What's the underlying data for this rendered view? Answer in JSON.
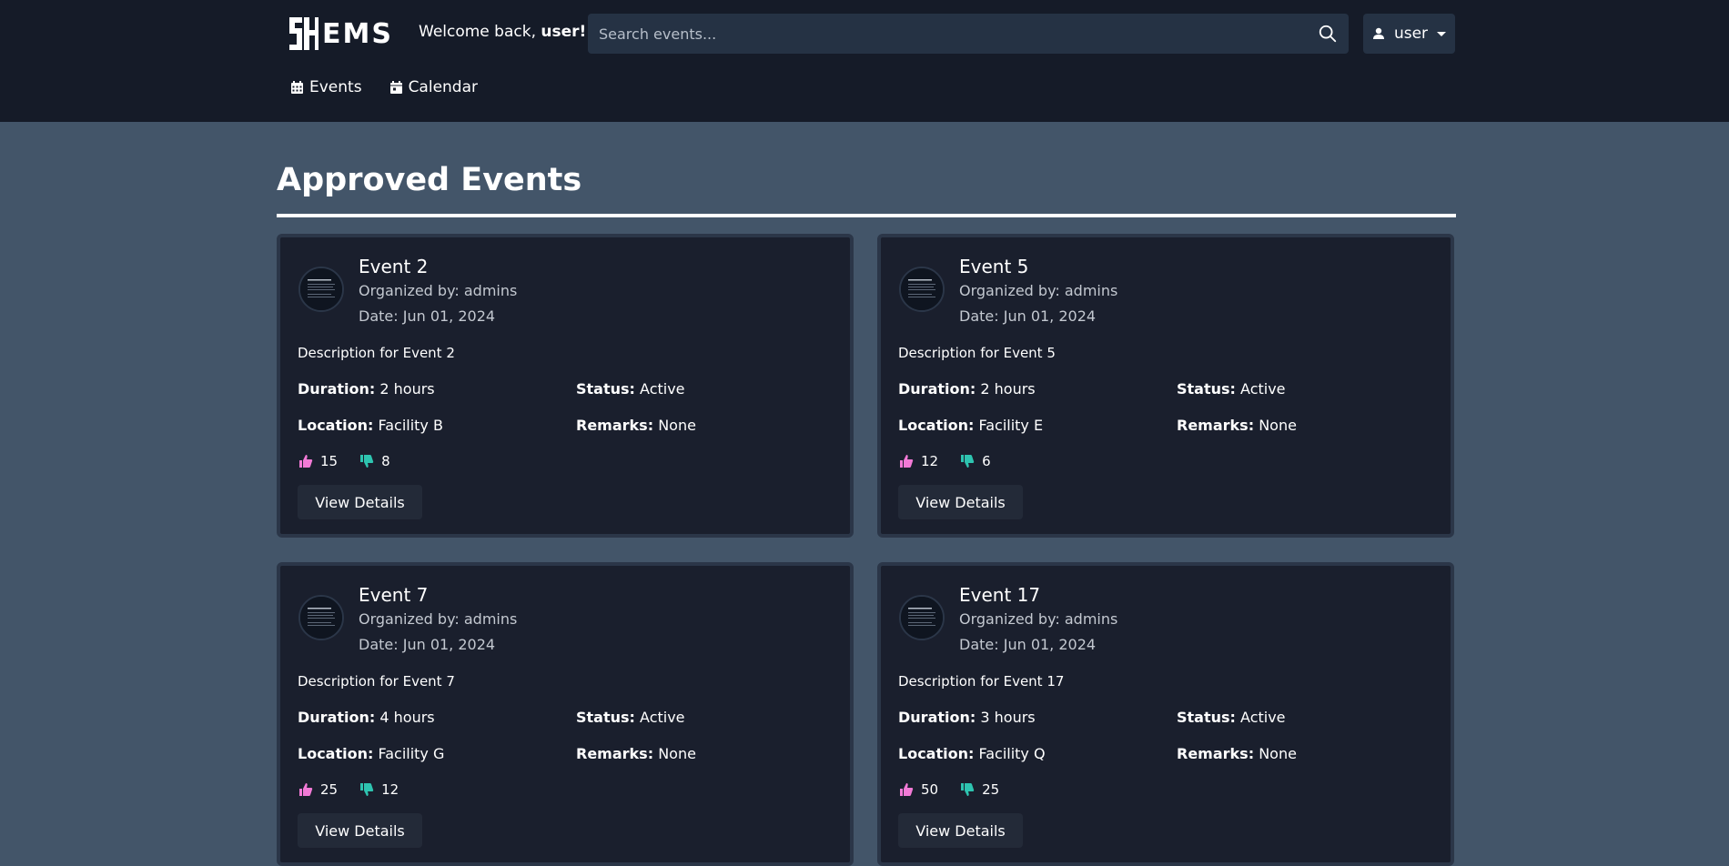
{
  "header": {
    "logo_text": "EMS",
    "welcome_prefix": "Welcome back,",
    "welcome_user": "user!",
    "search_placeholder": "Search events...",
    "user_menu_label": "user",
    "nav": [
      {
        "label": "Events",
        "icon": "calendar-grid-icon"
      },
      {
        "label": "Calendar",
        "icon": "calendar-icon"
      }
    ]
  },
  "main": {
    "title": "Approved Events",
    "labels": {
      "organized_prefix": "Organized by:",
      "date_prefix": "Date:",
      "duration": "Duration:",
      "status": "Status:",
      "location": "Location:",
      "remarks": "Remarks:",
      "view_details": "View Details"
    },
    "events": [
      {
        "name": "Event 2",
        "organizer": "admins",
        "date": "Jun 01, 2024",
        "description": "Description for Event 2",
        "duration": "2 hours",
        "status": "Active",
        "location": "Facility B",
        "remarks": "None",
        "likes": "15",
        "dislikes": "8"
      },
      {
        "name": "Event 5",
        "organizer": "admins",
        "date": "Jun 01, 2024",
        "description": "Description for Event 5",
        "duration": "2 hours",
        "status": "Active",
        "location": "Facility E",
        "remarks": "None",
        "likes": "12",
        "dislikes": "6"
      },
      {
        "name": "Event 7",
        "organizer": "admins",
        "date": "Jun 01, 2024",
        "description": "Description for Event 7",
        "duration": "4 hours",
        "status": "Active",
        "location": "Facility G",
        "remarks": "None",
        "likes": "25",
        "dislikes": "12"
      },
      {
        "name": "Event 17",
        "organizer": "admins",
        "date": "Jun 01, 2024",
        "description": "Description for Event 17",
        "duration": "3 hours",
        "status": "Active",
        "location": "Facility Q",
        "remarks": "None",
        "likes": "50",
        "dislikes": "25"
      }
    ]
  },
  "colors": {
    "header_bg": "#151b28",
    "page_bg": "#435569",
    "card_bg": "#1a1f2d",
    "like_color": "#f27ad6",
    "dislike_color": "#2ec4b0"
  }
}
